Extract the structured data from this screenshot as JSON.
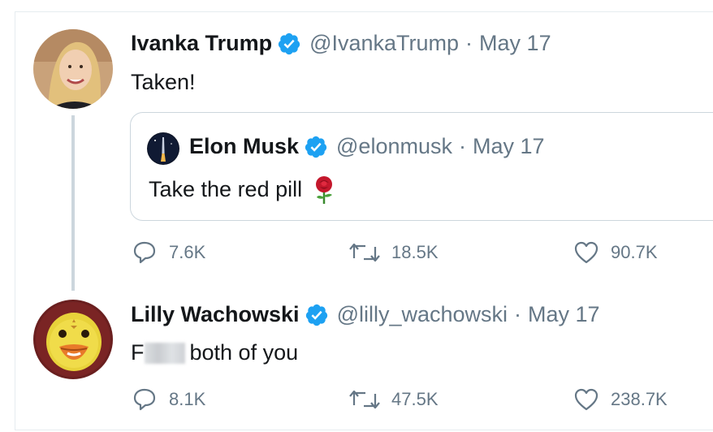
{
  "tweets": [
    {
      "name": "Ivanka Trump",
      "handle": "@IvankaTrump",
      "separator": "·",
      "date": "May 17",
      "text": "Taken!",
      "quoted": {
        "name": "Elon Musk",
        "handle": "@elonmusk",
        "separator": "·",
        "date": "May 17",
        "text": "Take the red pill",
        "emoji": "rose-emoji"
      },
      "actions": {
        "replies": "7.6K",
        "retweets": "18.5K",
        "likes": "90.7K"
      }
    },
    {
      "name": "Lilly Wachowski",
      "handle": "@lilly_wachowski",
      "separator": "·",
      "date": "May 17",
      "text_start": "F",
      "text_end": "both of you",
      "actions": {
        "replies": "8.1K",
        "retweets": "47.5K",
        "likes": "238.7K"
      }
    }
  ],
  "colors": {
    "verified": "#1da1f2",
    "secondary_text": "#657786",
    "primary_text": "#14171a",
    "thread_line": "#ccd6dd"
  },
  "icons": [
    "verified-badge-icon",
    "reply-icon",
    "retweet-icon",
    "like-icon",
    "rose-emoji"
  ]
}
